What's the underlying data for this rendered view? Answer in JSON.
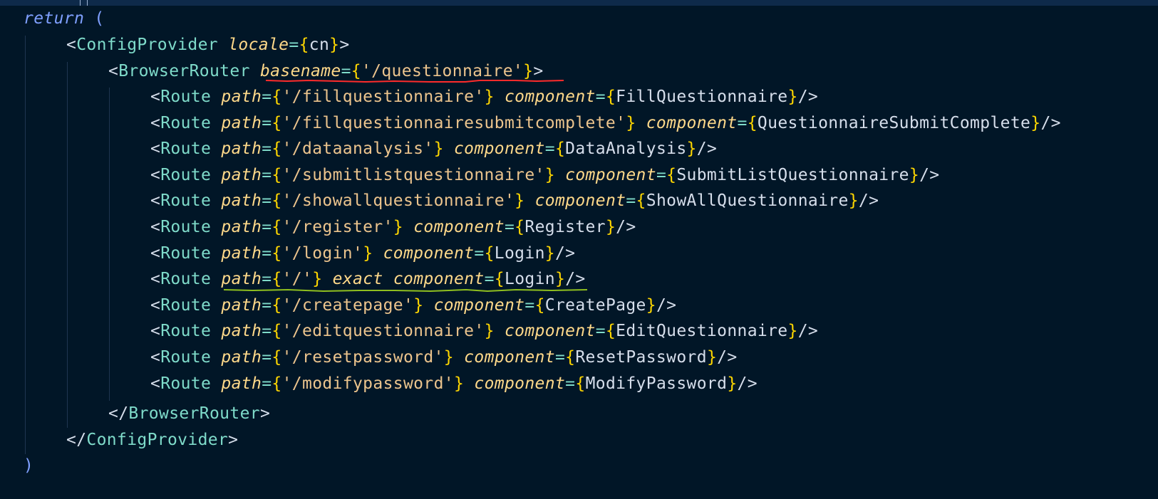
{
  "editor": {
    "return_keyword": "return",
    "open_paren": "(",
    "close_paren": ")",
    "config_provider": {
      "tag": "ConfigProvider",
      "attr": "locale",
      "value": "cn"
    },
    "browser_router": {
      "tag": "BrowserRouter",
      "attr": "basename",
      "value": "'/questionnaire'"
    },
    "route_tag": "Route",
    "path_attr": "path",
    "component_attr": "component",
    "exact_attr": "exact",
    "routes": [
      {
        "path": "'/fillquestionnaire'",
        "component": "FillQuestionnaire"
      },
      {
        "path": "'/fillquestionnairesubmitcomplete'",
        "component": "QuestionnaireSubmitComplete"
      },
      {
        "path": "'/dataanalysis'",
        "component": "DataAnalysis"
      },
      {
        "path": "'/submitlistquestionnaire'",
        "component": "SubmitListQuestionnaire"
      },
      {
        "path": "'/showallquestionnaire'",
        "component": "ShowAllQuestionnaire"
      },
      {
        "path": "'/register'",
        "component": "Register"
      },
      {
        "path": "'/login'",
        "component": "Login"
      },
      {
        "path": "'/'",
        "component": "Login",
        "exact": true
      },
      {
        "path": "'/createpage'",
        "component": "CreatePage"
      },
      {
        "path": "'/editquestionnaire'",
        "component": "EditQuestionnaire"
      },
      {
        "path": "'/resetpassword'",
        "component": "ResetPassword"
      },
      {
        "path": "'/modifypassword'",
        "component": "ModifyPassword"
      }
    ],
    "colors": {
      "background": "#011627",
      "keyword": "#7fa0ff",
      "tag": "#7fdbca",
      "attribute": "#ffd98a",
      "brace": "#ffd700",
      "string": "#ecc48d",
      "squiggle_error": "#ff2b2b",
      "squiggle_warning": "#8fbf1f"
    }
  }
}
